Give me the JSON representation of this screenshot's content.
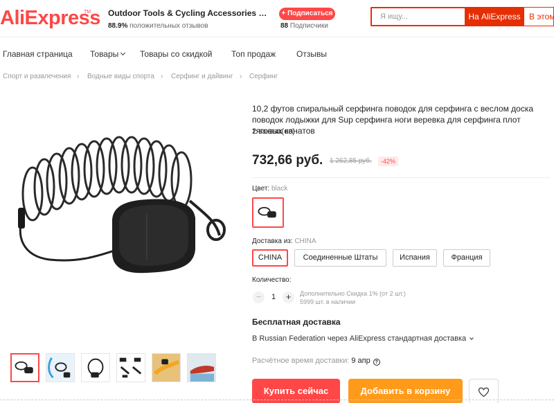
{
  "header": {
    "logo": "AliExpress",
    "logo_tm": "TM",
    "store_name": "Outdoor Tools & Cycling Accessories St...",
    "positive_percent": "88.9%",
    "positive_label": "положительных отзывов",
    "subscribe_label": "+ Подписаться",
    "subscribers_count": "88",
    "subscribers_label": "Подписчики",
    "search_placeholder": "Я ищу...",
    "search_ali_label": "На AliExpress",
    "search_store_label": "В этом"
  },
  "nav": {
    "items": [
      "Главная страница",
      "Товары",
      "Товары со скидкой",
      "Топ продаж",
      "Отзывы"
    ]
  },
  "breadcrumb": [
    "Спорт и развлечения",
    "Водные виды спорта",
    "Серфинг и дайвинг",
    "Серфинг"
  ],
  "product": {
    "title": "10,2 футов спиральный серфинга поводок для серфинга с веслом доска поводок лодыжки для Sup серфинга ноги веревка для серфинга плот тяговых канатов",
    "orders": "2 заказа(ов)",
    "price": "732,66 руб.",
    "old_price": "1 262,85 руб.",
    "discount": "-42%",
    "color_label": "Цвет:",
    "color_value": "black",
    "ship_from_label": "Доставка из:",
    "ship_from_value": "CHINA",
    "ship_options": [
      "CHINA",
      "Соединенные Штаты",
      "Испания",
      "Франция"
    ],
    "quantity_label": "Количество:",
    "quantity": "1",
    "qty_minus": "−",
    "qty_plus": "+",
    "qty_discount": "Дополнительно Скидка 1% (от 2 шт.)",
    "stock": "5999 шт. в наличии",
    "free_shipping": "Бесплатная доставка",
    "shipping_method": "В Russian Federation через AliExpress стандартная доставка",
    "delivery_label": "Расчётное время доставки:",
    "delivery_date": "9 апр",
    "help_glyph": "?",
    "buy_now": "Купить сейчас",
    "add_to_cart": "Добавить в корзину"
  },
  "colors": {
    "brand_red": "#ff4747",
    "cart_orange": "#ff9a1a",
    "search_red": "#e62e04"
  },
  "icons": [
    "chevron-down-icon",
    "breadcrumb-separator-icon",
    "help-icon",
    "heart-icon"
  ]
}
